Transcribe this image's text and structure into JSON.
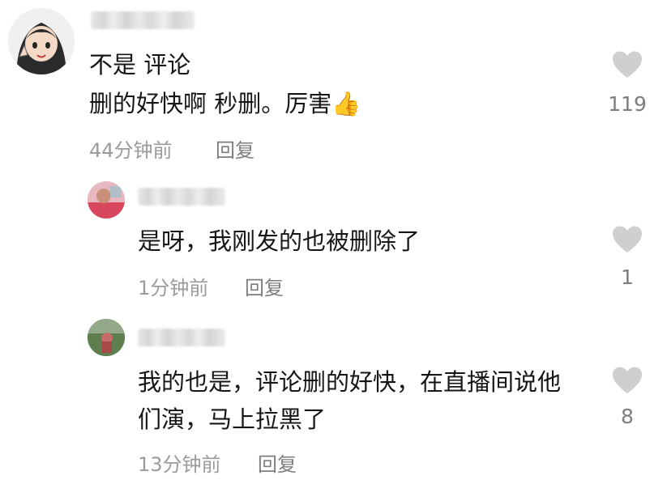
{
  "comments": [
    {
      "text_lines": [
        "不是 评论",
        "删的好快啊 秒删。厉害👍"
      ],
      "time": "44分钟前",
      "reply": "回复",
      "likes": "119"
    },
    {
      "text_lines": [
        "是呀，我刚发的也被删除了"
      ],
      "time": "1分钟前",
      "reply": "回复",
      "likes": "1"
    },
    {
      "text_lines": [
        "我的也是，评论删的好快，在直播间说他",
        "们演，马上拉黑了"
      ],
      "time": "13分钟前",
      "reply": "回复",
      "likes": "8"
    }
  ],
  "icons": {
    "like": "heart-icon"
  },
  "colors": {
    "text": "#161616",
    "meta": "#9b9b9b",
    "heart": "#cfcfcf"
  }
}
